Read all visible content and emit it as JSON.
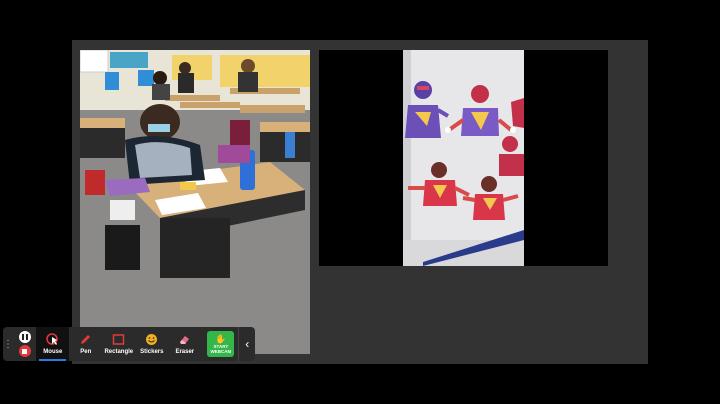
{
  "toolbar": {
    "tools": [
      {
        "label": "Mouse",
        "icon": "mouse-cursor-icon"
      },
      {
        "label": "Pen",
        "icon": "pen-icon"
      },
      {
        "label": "Rectangle",
        "icon": "rectangle-icon"
      },
      {
        "label": "Stickers",
        "icon": "sticker-smiley-icon"
      },
      {
        "label": "Eraser",
        "icon": "eraser-icon"
      }
    ],
    "webcam_line1": "START",
    "webcam_line2": "WEBCAM"
  },
  "colors": {
    "stage": "#333333",
    "accent_blue": "#2c7be5",
    "webcam_green": "#33b74a",
    "stop_red": "#e23a3a"
  }
}
